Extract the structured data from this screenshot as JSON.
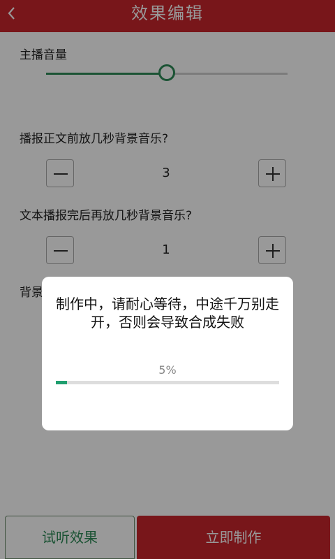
{
  "header": {
    "title": "效果编辑",
    "back_icon": "chevron-left-icon"
  },
  "volume": {
    "label": "主播音量",
    "level": 0.5
  },
  "pre_music": {
    "question": "播报正文前放几秒背景音乐?",
    "value": "3"
  },
  "post_music": {
    "question": "文本播报完后再放几秒背景音乐?",
    "value": "1"
  },
  "background": {
    "label_partial": "背景"
  },
  "buttons": {
    "preview": "试听效果",
    "make": "立即制作"
  },
  "dialog": {
    "message": "制作中，请耐心等待，中途千万别走开，否则会导致合成失败",
    "percent_text": "5%",
    "progress": 0.05
  },
  "colors": {
    "brand": "#c8262c",
    "accent": "#2e8b57",
    "progress": "#1f9e6e"
  }
}
